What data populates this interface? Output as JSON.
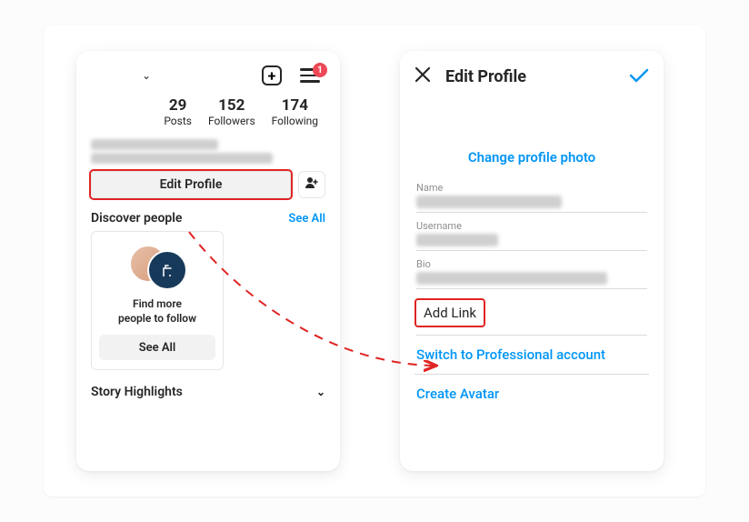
{
  "left": {
    "notif_count": "1",
    "stats": {
      "posts_num": "29",
      "posts_lbl": "Posts",
      "followers_num": "152",
      "followers_lbl": "Followers",
      "following_num": "174",
      "following_lbl": "Following"
    },
    "edit_profile": "Edit Profile",
    "discover_title": "Discover people",
    "discover_see_all": "See All",
    "dp_card_line1": "Find more",
    "dp_card_line2": "people to follow",
    "dp_card_btn": "See All",
    "story_highlights": "Story Highlights"
  },
  "right": {
    "title": "Edit Profile",
    "change_photo": "Change profile photo",
    "name_label": "Name",
    "username_label": "Username",
    "bio_label": "Bio",
    "add_link": "Add Link",
    "switch_pro": "Switch to Professional account",
    "create_avatar": "Create Avatar"
  }
}
